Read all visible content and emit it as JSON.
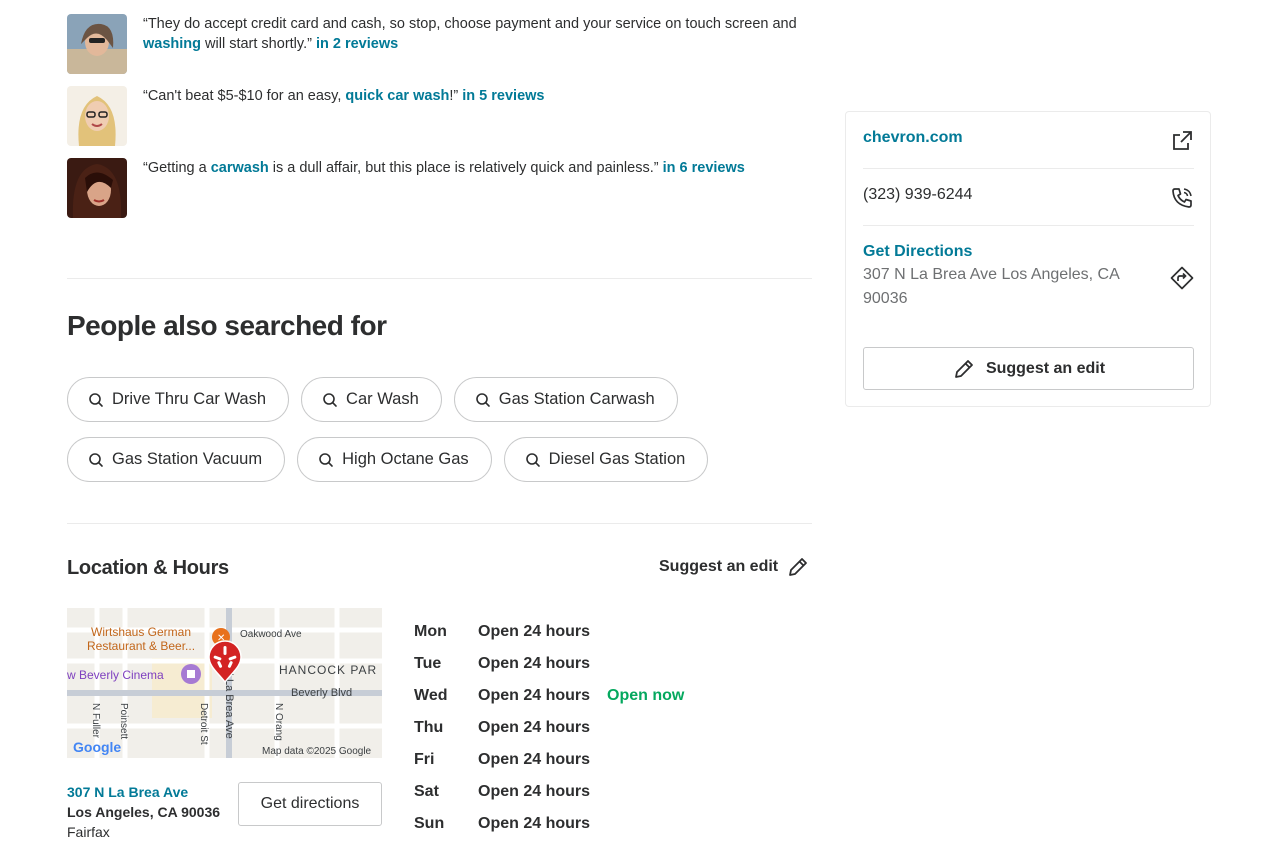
{
  "reviews": [
    {
      "pre": "“They do accept credit card and cash, so stop, choose payment and your service on touch screen and ",
      "keyword": "washing",
      "post": " will start shortly.”",
      "count": "in 2 reviews"
    },
    {
      "pre": "“Can't beat $5-$10 for an easy, ",
      "keyword": "quick car wash",
      "post": "!”",
      "count": "in 5 reviews"
    },
    {
      "pre": "“Getting a ",
      "keyword": "carwash",
      "post": " is a dull affair, but this place is relatively quick and painless.”",
      "count": "in 6 reviews"
    }
  ],
  "people_also_searched": {
    "title": "People also searched for",
    "chips": [
      "Drive Thru Car Wash",
      "Car Wash",
      "Gas Station Carwash",
      "Gas Station Vacuum",
      "High Octane Gas",
      "Diesel Gas Station"
    ]
  },
  "location": {
    "title": "Location & Hours",
    "suggest_edit": "Suggest an edit",
    "map_labels": {
      "restaurant": "Wirtshaus German",
      "restaurant2": "Restaurant & Beer...",
      "oakwood": "Oakwood Ave",
      "hancock": "HANCOCK PAR",
      "cinema": "w Beverly Cinema",
      "beverly": "Beverly Blvd",
      "fuller": "N Fuller",
      "poinsett": "Poinsett",
      "detroit": "Detroit St",
      "labrea": "N La Brea Ave",
      "orange": "N Orang",
      "google": "Google",
      "credit": "Map data ©2025 Google"
    },
    "street": "307 N La Brea Ave",
    "city": "Los Angeles, CA 90036",
    "neighborhood": "Fairfax",
    "directions_button": "Get directions",
    "hours": [
      {
        "day": "Mon",
        "time": "Open 24 hours",
        "status": ""
      },
      {
        "day": "Tue",
        "time": "Open 24 hours",
        "status": ""
      },
      {
        "day": "Wed",
        "time": "Open 24 hours",
        "status": "Open now"
      },
      {
        "day": "Thu",
        "time": "Open 24 hours",
        "status": ""
      },
      {
        "day": "Fri",
        "time": "Open 24 hours",
        "status": ""
      },
      {
        "day": "Sat",
        "time": "Open 24 hours",
        "status": ""
      },
      {
        "day": "Sun",
        "time": "Open 24 hours",
        "status": ""
      }
    ]
  },
  "sidebar": {
    "website": "chevron.com",
    "phone": "(323) 939-6244",
    "directions_label": "Get Directions",
    "address_line1": "307 N La Brea Ave Los Angeles, CA",
    "address_line2": "90036",
    "suggest_edit": "Suggest an edit",
    "icons": [
      "external-link-icon",
      "phone-icon",
      "directions-icon",
      "pencil-icon"
    ]
  },
  "colors": {
    "link": "#027a97",
    "open_now": "#04a85e",
    "yelp_red": "#d32323"
  }
}
